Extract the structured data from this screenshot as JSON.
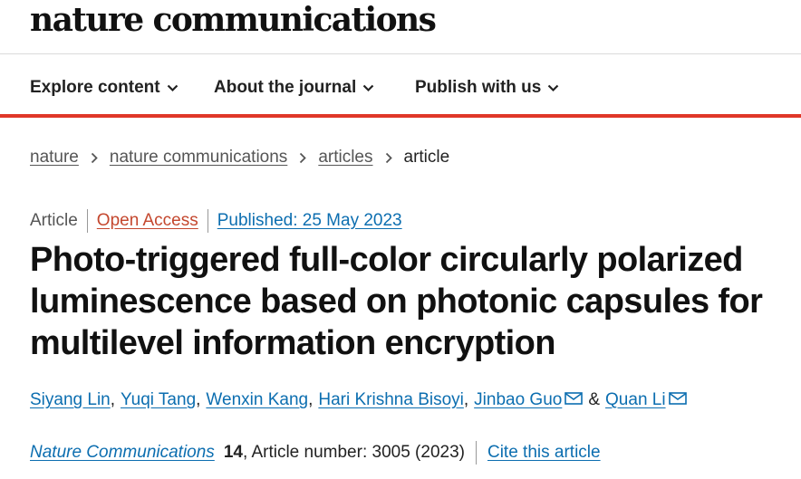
{
  "site": {
    "logo_text": "nature communications"
  },
  "nav": {
    "items": [
      {
        "label": "Explore content"
      },
      {
        "label": "About the journal"
      },
      {
        "label": "Publish with us"
      }
    ]
  },
  "breadcrumb": {
    "items": [
      "nature",
      "nature communications",
      "articles"
    ],
    "current": "article"
  },
  "article_meta": {
    "type": "Article",
    "access": "Open Access",
    "published_label": "Published: 25 May 2023"
  },
  "article": {
    "title": "Photo-triggered full-color circularly polarized luminescence based on photonic capsules for multilevel information encryption",
    "authors": [
      {
        "name": "Siyang Lin",
        "corresponding": false
      },
      {
        "name": "Yuqi Tang",
        "corresponding": false
      },
      {
        "name": "Wenxin Kang",
        "corresponding": false
      },
      {
        "name": "Hari Krishna Bisoyi",
        "corresponding": false
      },
      {
        "name": "Jinbao Guo",
        "corresponding": true
      },
      {
        "name": "Quan Li",
        "corresponding": true
      }
    ],
    "author_separator": ",",
    "last_author_joiner": "&"
  },
  "citation": {
    "journal": "Nature Communications",
    "volume": "14",
    "details": ", Article number: 3005 (2023)",
    "cite_link": "Cite this article"
  },
  "colors": {
    "accent_red": "#e03728",
    "link_blue": "#0c6eb0",
    "open_access_orange": "#c4472e"
  },
  "icons": {
    "nav_chevron": "chevron-down-icon",
    "breadcrumb_separator": "chevron-right-icon",
    "corresponding_author": "mail-icon"
  }
}
